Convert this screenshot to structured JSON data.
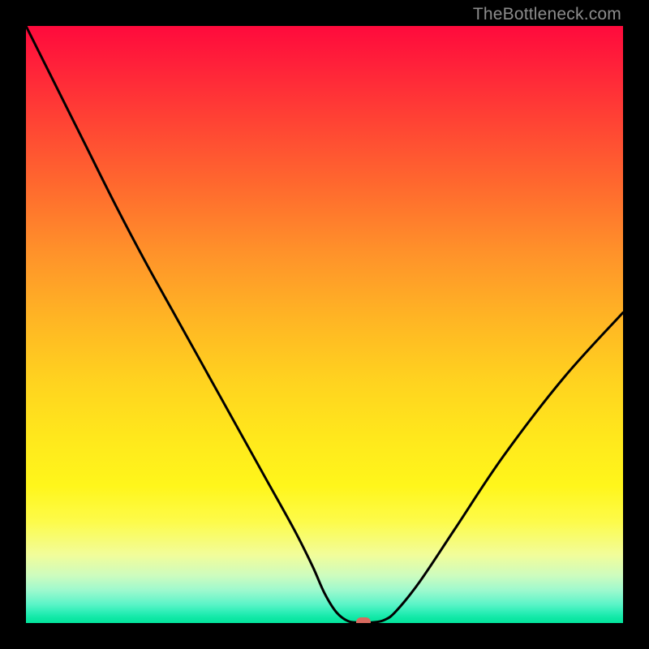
{
  "watermark": "TheBottleneck.com",
  "chart_data": {
    "type": "line",
    "title": "",
    "xlabel": "",
    "ylabel": "",
    "xlim": [
      0,
      100
    ],
    "ylim": [
      0,
      100
    ],
    "grid": false,
    "legend": false,
    "background_gradient": {
      "type": "vertical",
      "stops": [
        {
          "pos": 0.0,
          "color": "#ff0a3c"
        },
        {
          "pos": 0.3,
          "color": "#ff7a2c"
        },
        {
          "pos": 0.6,
          "color": "#ffd41f"
        },
        {
          "pos": 0.8,
          "color": "#fff61b"
        },
        {
          "pos": 0.92,
          "color": "#cefcbe"
        },
        {
          "pos": 1.0,
          "color": "#03e49c"
        }
      ]
    },
    "series": [
      {
        "name": "bottleneck-curve",
        "color": "#000000",
        "x": [
          0.0,
          3.0,
          6.0,
          10.0,
          15.0,
          20.0,
          25.0,
          30.0,
          35.0,
          40.0,
          45.0,
          48.0,
          50.0,
          52.0,
          54.0,
          56.0,
          58.0,
          60.0,
          62.0,
          66.0,
          72.0,
          80.0,
          90.0,
          100.0
        ],
        "y": [
          100.0,
          94.0,
          88.0,
          80.0,
          70.0,
          60.5,
          51.5,
          42.5,
          33.5,
          24.5,
          15.5,
          9.5,
          5.0,
          1.8,
          0.3,
          0.1,
          0.1,
          0.5,
          2.0,
          7.0,
          16.0,
          28.0,
          41.0,
          52.0
        ]
      }
    ],
    "marker": {
      "label": "optimal-point",
      "x": 56.5,
      "y": 0.2,
      "color": "#d86a5f"
    }
  }
}
